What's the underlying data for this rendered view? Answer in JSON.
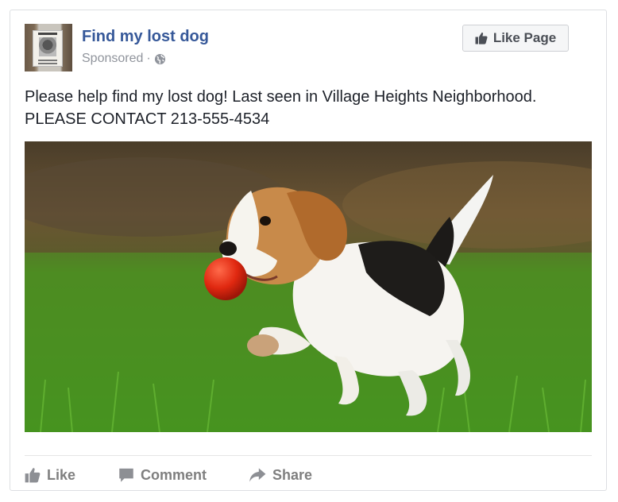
{
  "post": {
    "page_name": "Find my lost dog",
    "sponsored_label": "Sponsored",
    "separator": "·",
    "privacy_icon": "globe-icon",
    "like_page_label": "Like Page",
    "text_line1": "Please help find my lost dog! Last seen in Village Heights Neighborhood.",
    "text_line2": "PLEASE CONTACT 213-555-4534",
    "avatar_poster_text": "LOST DOG",
    "image_subject": "beagle puppy running on grass with red ball"
  },
  "actions": {
    "like_label": "Like",
    "comment_label": "Comment",
    "share_label": "Share"
  },
  "colors": {
    "page_name": "#365899",
    "muted": "#90949c",
    "action_text": "#7f7f7f",
    "button_bg": "#f5f6f7",
    "border": "#dddfe2"
  }
}
